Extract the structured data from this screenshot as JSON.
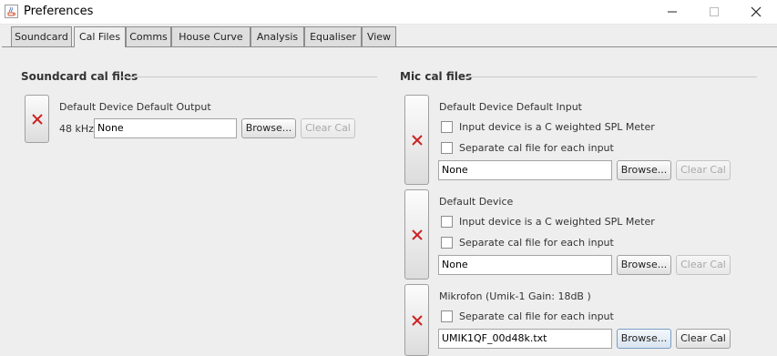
{
  "window": {
    "title": "Preferences",
    "app_icon": "java-cup-icon",
    "controls": [
      "minimize-icon",
      "maximize-icon",
      "close-icon"
    ]
  },
  "tabs": [
    {
      "label": "Soundcard",
      "active": false
    },
    {
      "label": "Cal Files",
      "active": true
    },
    {
      "label": "Comms",
      "active": false
    },
    {
      "label": "House Curve",
      "active": false
    },
    {
      "label": "Analysis",
      "active": false
    },
    {
      "label": "Equaliser",
      "active": false
    },
    {
      "label": "View",
      "active": false
    }
  ],
  "soundcard": {
    "section_title": "Soundcard cal files",
    "device_name": "Default Device Default Output",
    "rate": "48 kHz",
    "file_value": "None",
    "browse_label": "Browse...",
    "clear_label": "Clear Cal",
    "clear_enabled": false
  },
  "mic": {
    "section_title": "Mic cal files",
    "devices": [
      {
        "name": "Default Device Default Input",
        "spl_label": "Input device is a C weighted SPL Meter",
        "spl_checked": false,
        "separate_label": "Separate cal file for each input",
        "separate_checked": false,
        "file_value": "None",
        "browse_label": "Browse...",
        "clear_label": "Clear Cal",
        "clear_enabled": false
      },
      {
        "name": "Default Device",
        "spl_label": "Input device is a C weighted SPL Meter",
        "spl_checked": false,
        "separate_label": "Separate cal file for each input",
        "separate_checked": false,
        "file_value": "None",
        "browse_label": "Browse...",
        "clear_label": "Clear Cal",
        "clear_enabled": false
      },
      {
        "name": "Mikrofon (Umik-1  Gain: 18dB  )",
        "separate_label": "Separate cal file for each input",
        "separate_checked": false,
        "file_value": "UMIK1QF_00d48k.txt",
        "browse_label": "Browse...",
        "clear_label": "Clear Cal",
        "clear_enabled": true
      }
    ]
  },
  "colors": {
    "remove_x": "#cc2222",
    "background": "#eeeeee"
  }
}
